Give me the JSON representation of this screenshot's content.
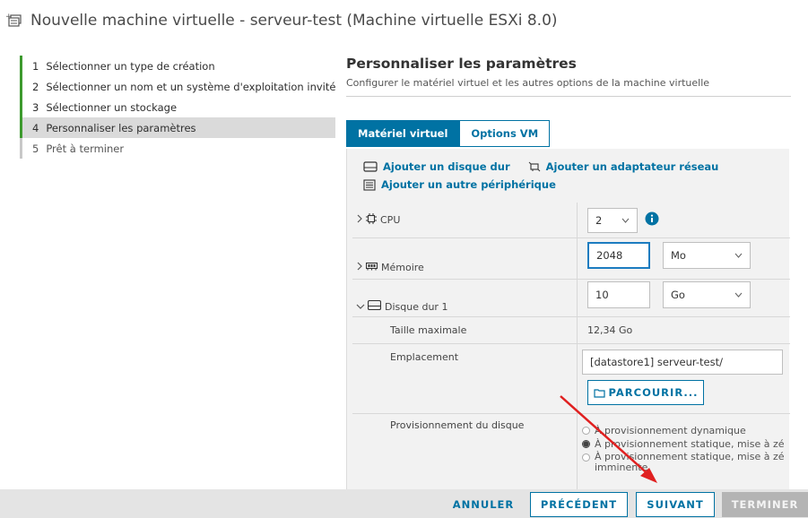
{
  "window": {
    "title": "Nouvelle machine virtuelle - serveur-test (Machine virtuelle ESXi 8.0)",
    "icon": "new-vm-icon"
  },
  "steps": [
    {
      "num": "1",
      "label": "Sélectionner un type de création",
      "state": "done"
    },
    {
      "num": "2",
      "label": "Sélectionner un nom et un système d'exploitation invité",
      "state": "done"
    },
    {
      "num": "3",
      "label": "Sélectionner un stockage",
      "state": "done"
    },
    {
      "num": "4",
      "label": "Personnaliser les paramètres",
      "state": "current"
    },
    {
      "num": "5",
      "label": "Prêt à terminer",
      "state": "future"
    }
  ],
  "main": {
    "title": "Personnaliser les paramètres",
    "subtitle": "Configurer le matériel virtuel et les autres options de la machine virtuelle"
  },
  "tabs": [
    {
      "label": "Matériel virtuel",
      "active": true
    },
    {
      "label": "Options VM",
      "active": false
    }
  ],
  "toolbar": {
    "add_disk": "Ajouter un disque dur",
    "add_network": "Ajouter un adaptateur réseau",
    "add_device": "Ajouter un autre périphérique"
  },
  "hardware": {
    "cpu": {
      "label": "CPU",
      "value": "2"
    },
    "memory": {
      "label": "Mémoire",
      "value": "2048",
      "unit": "Mo"
    },
    "disk": {
      "label": "Disque dur 1",
      "value": "10",
      "unit": "Go",
      "max_size_label": "Taille maximale",
      "max_size_value": "12,34 Go",
      "location_label": "Emplacement",
      "location_value": "[datastore1] serveur-test/",
      "browse_label": "PARCOURIR...",
      "provisioning_label": "Provisionnement du disque",
      "provisioning_options": [
        {
          "label": "À provisionnement dynamique",
          "checked": false
        },
        {
          "label": "À provisionnement statique, mise à zé",
          "checked": true
        },
        {
          "label": "À provisionnement statique, mise à zé",
          "checked": false
        }
      ],
      "provisioning_option3_cont": "imminente"
    }
  },
  "footer": {
    "cancel": "ANNULER",
    "previous": "PRÉCÉDENT",
    "next": "SUIVANT",
    "finish": "TERMINER"
  },
  "colors": {
    "accent": "#0072a3",
    "step_done": "#3d9a2e",
    "annotation_arrow": "#e02020"
  }
}
